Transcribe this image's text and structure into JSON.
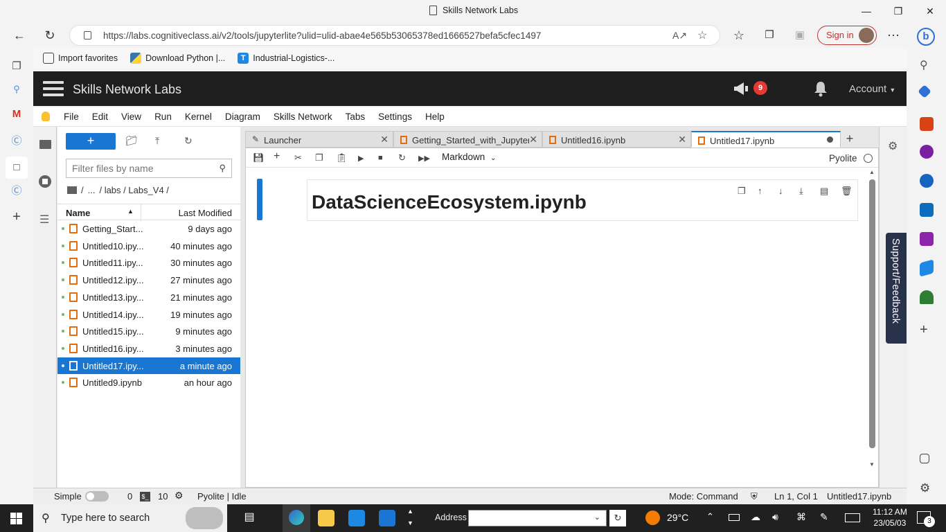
{
  "browser": {
    "title": "Skills Network Labs",
    "url": "https://labs.cognitiveclass.ai/v2/tools/jupyterlite?ulid=ulid-abae4e565b53065378ed1666527befa5cfec1497",
    "signin_label": "Sign in",
    "favorites": [
      {
        "label": "Import favorites",
        "icon": "folder-icon"
      },
      {
        "label": "Download Python |...",
        "icon": "python-icon"
      },
      {
        "label": "Industrial-Logistics-...",
        "icon": "t-app-icon"
      }
    ]
  },
  "app": {
    "brand": "Skills Network Labs",
    "notification_count": "9",
    "account_label": "Account"
  },
  "menu": [
    "File",
    "Edit",
    "View",
    "Run",
    "Kernel",
    "Diagram",
    "Skills Network",
    "Tabs",
    "Settings",
    "Help"
  ],
  "filebrowser": {
    "new_label": "+",
    "filter_placeholder": "Filter files by name",
    "breadcrumb": [
      "/",
      "...",
      "/ labs / Labs_V4 /"
    ],
    "col_name": "Name",
    "col_modified": "Last Modified",
    "files": [
      {
        "name": "Getting_Start...",
        "modified": "9 days ago"
      },
      {
        "name": "Untitled10.ipy...",
        "modified": "40 minutes ago"
      },
      {
        "name": "Untitled11.ipy...",
        "modified": "30 minutes ago"
      },
      {
        "name": "Untitled12.ipy...",
        "modified": "27 minutes ago"
      },
      {
        "name": "Untitled13.ipy...",
        "modified": "21 minutes ago"
      },
      {
        "name": "Untitled14.ipy...",
        "modified": "19 minutes ago"
      },
      {
        "name": "Untitled15.ipy...",
        "modified": "9 minutes ago"
      },
      {
        "name": "Untitled16.ipy...",
        "modified": "3 minutes ago"
      },
      {
        "name": "Untitled17.ipy...",
        "modified": "a minute ago"
      },
      {
        "name": "Untitled9.ipynb",
        "modified": "an hour ago"
      }
    ]
  },
  "tabs": [
    {
      "label": "Launcher"
    },
    {
      "label": "Getting_Started_with_Jupyter"
    },
    {
      "label": "Untitled16.ipynb"
    },
    {
      "label": "Untitled17.ipynb"
    }
  ],
  "notebook": {
    "cell_type": "Markdown",
    "kernel": "Pyolite",
    "cell_heading": "DataScienceEcosystem.ipynb"
  },
  "support_label": "Support/Feedback",
  "statusbar": {
    "simple": "Simple",
    "count_a": "0",
    "count_b": "10",
    "kernel_status": "Pyolite | Idle",
    "mode": "Mode: Command",
    "position": "Ln 1, Col 1",
    "file": "Untitled17.ipynb"
  },
  "taskbar": {
    "search_placeholder": "Type here to search",
    "address_label": "Address",
    "temperature": "29°C",
    "time": "11:12 AM",
    "date": "23/05/03",
    "notif_count": "3"
  }
}
